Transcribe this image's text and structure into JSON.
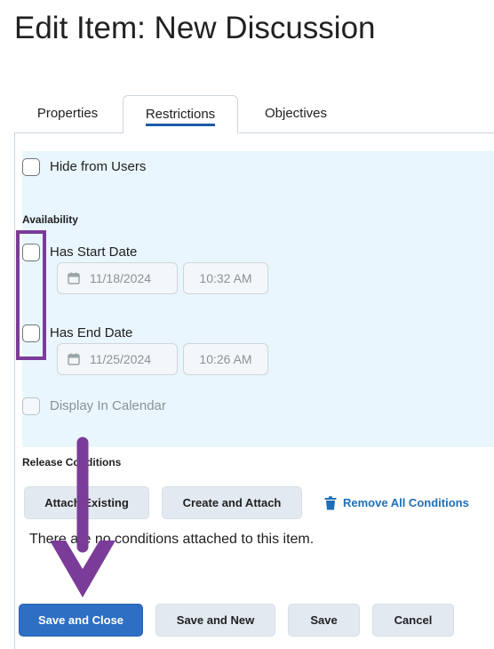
{
  "page": {
    "title": "Edit Item: New Discussion"
  },
  "tabs": [
    {
      "label": "Properties",
      "active": false
    },
    {
      "label": "Restrictions",
      "active": true
    },
    {
      "label": "Objectives",
      "active": false
    }
  ],
  "restrictions": {
    "hide_from_users_label": "Hide from Users",
    "availability_heading": "Availability",
    "start": {
      "label": "Has Start Date",
      "date": "11/18/2024",
      "time": "10:32 AM"
    },
    "end": {
      "label": "Has End Date",
      "date": "11/25/2024",
      "time": "10:26 AM"
    },
    "display_in_calendar_label": "Display In Calendar"
  },
  "release_conditions": {
    "heading": "Release Conditions",
    "attach_existing_label": "Attach Existing",
    "create_and_attach_label": "Create and Attach",
    "remove_all_label": "Remove All Conditions",
    "empty_message": "There are no conditions attached to this item."
  },
  "actions": {
    "save_and_close": "Save and Close",
    "save_and_new": "Save and New",
    "save": "Save",
    "cancel": "Cancel"
  },
  "colors": {
    "primary": "#2e6fc4",
    "annotation": "#7b3c99",
    "panel_bg": "#e9f6fd",
    "link": "#1e6fb8"
  },
  "icons": {
    "calendar": "calendar-icon",
    "trash": "trash-icon",
    "annotation_arrow": "down-arrow-icon"
  }
}
